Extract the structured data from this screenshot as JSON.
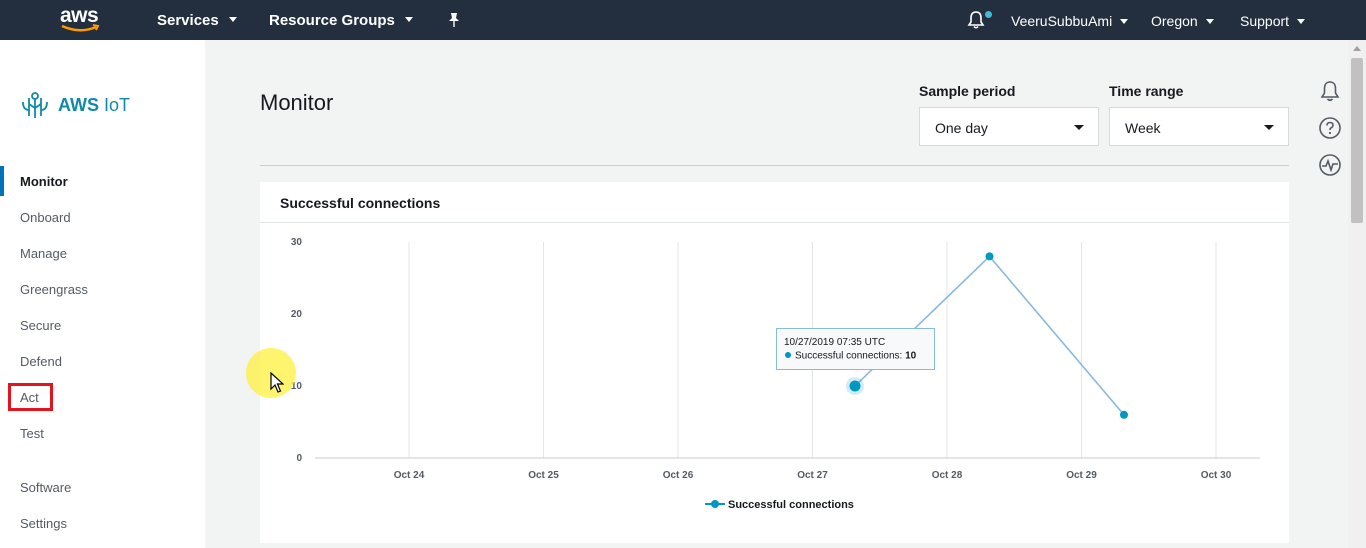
{
  "topnav": {
    "logo": "aws",
    "services_label": "Services",
    "resource_groups_label": "Resource Groups",
    "user_label": "VeeruSubbuAmi",
    "region_label": "Oregon",
    "support_label": "Support"
  },
  "sidebar": {
    "brand": "AWS",
    "brand_suffix": "IoT",
    "items": [
      {
        "label": "Monitor",
        "active": true
      },
      {
        "label": "Onboard"
      },
      {
        "label": "Manage"
      },
      {
        "label": "Greengrass"
      },
      {
        "label": "Secure"
      },
      {
        "label": "Defend"
      },
      {
        "label": "Act",
        "highlighted": true
      },
      {
        "label": "Test"
      },
      {
        "label": "Software"
      },
      {
        "label": "Settings"
      }
    ]
  },
  "main": {
    "title": "Monitor",
    "sample_period": {
      "label": "Sample period",
      "value": "One day"
    },
    "time_range": {
      "label": "Time range",
      "value": "Week"
    }
  },
  "card": {
    "title": "Successful connections",
    "tooltip": {
      "date": "10/27/2019 07:35 UTC",
      "series": "Successful connections:",
      "value": "10"
    }
  },
  "chart_data": {
    "type": "line",
    "title": "Successful connections",
    "x_ticks": [
      "Oct 24",
      "Oct 25",
      "Oct 26",
      "Oct 27",
      "Oct 28",
      "Oct 29",
      "Oct 30"
    ],
    "y_ticks": [
      0,
      10,
      20,
      30
    ],
    "ylim": [
      0,
      30
    ],
    "series": [
      {
        "name": "Successful connections",
        "color": "#0097c3",
        "points": [
          {
            "x": "2019-10-27T07:35",
            "y": 10
          },
          {
            "x": "2019-10-28T07:35",
            "y": 28
          },
          {
            "x": "2019-10-29T07:35",
            "y": 6
          }
        ]
      }
    ],
    "grid": "vertical",
    "legend": "bottom-center"
  },
  "colors": {
    "nav_bg": "#232f3e",
    "accent": "#0073bb",
    "brand": "#0f8aa8",
    "highlight_box": "#e3141e",
    "series": "#0097c3"
  }
}
